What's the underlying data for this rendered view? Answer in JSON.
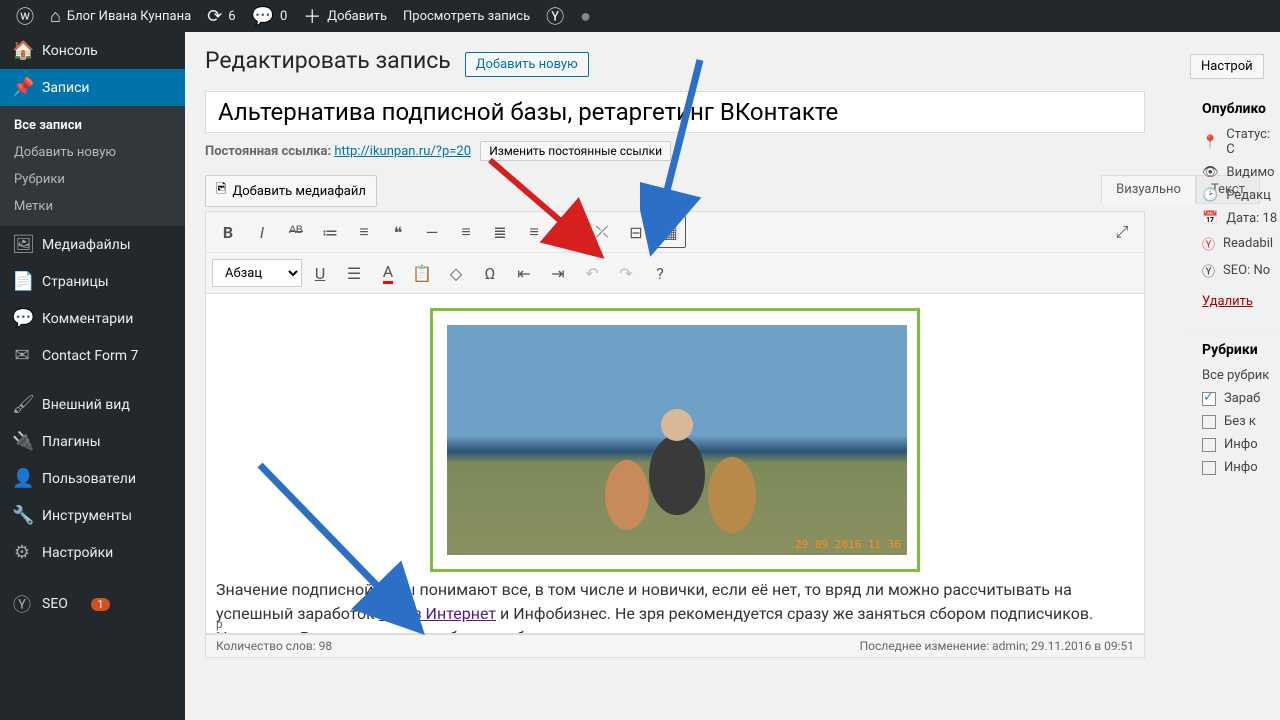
{
  "adminbar": {
    "site": "Блог Ивана Кунпана",
    "updates": "6",
    "comments": "0",
    "add": "Добавить",
    "view": "Просмотреть запись"
  },
  "menu": {
    "dashboard": "Консоль",
    "posts": "Записи",
    "posts_sub": {
      "all": "Все записи",
      "add": "Добавить новую",
      "cats": "Рубрики",
      "tags": "Метки"
    },
    "media": "Медиафайлы",
    "pages": "Страницы",
    "comments": "Комментарии",
    "cf7": "Contact Form 7",
    "appearance": "Внешний вид",
    "plugins": "Плагины",
    "users": "Пользователи",
    "tools": "Инструменты",
    "settings": "Настройки",
    "seo": "SEO",
    "seo_badge": "1"
  },
  "page": {
    "heading": "Редактировать запись",
    "add_new": "Добавить новую",
    "settings_tab": "Настрой",
    "title_value": "Альтернатива подписной базы, ретаргетинг ВКонтакте",
    "permalink_label": "Постоянная ссылка:",
    "permalink_url": "http://ikunpan.ru/?p=20",
    "permalink_edit": "Изменить постоянные ссылки",
    "add_media": "Добавить медиафайл",
    "tab_visual": "Визуально",
    "tab_text": "Текст",
    "paragraph": "Абзац"
  },
  "content": {
    "photo_stamp": "29 09 2016 11 36",
    "para": "Значение подписной базы понимают все, в том числе и новички, если её нет, то вряд ли можно рассчитывать на успешный заработок ",
    "link_text": "через Интернет",
    "para2": " и Инфобизнес. Не зря рекомендуется сразу же заняться сбором подписчиков. Например, Вы только создали блог, опубликовали первые статьи и сразу же нужно установить",
    "p_marker": "p"
  },
  "status": {
    "words_label": "Количество слов:",
    "words": "98",
    "last_edit": "Последнее изменение: admin; 29.11.2016 в 09:51"
  },
  "sidebar": {
    "publish": "Опублико",
    "status": "Статус: С",
    "visibility": "Видимо",
    "revisions": "Редакц",
    "date": "Дата: 18",
    "readability": "Readabil",
    "seo": "SEO: No",
    "trash": "Удалить",
    "cats_head": "Рубрики",
    "cats_all": "Все рубрик",
    "cat1": "Зараб",
    "cat2": "Без к",
    "cat3": "Инфо",
    "cat4": "Инфо"
  }
}
